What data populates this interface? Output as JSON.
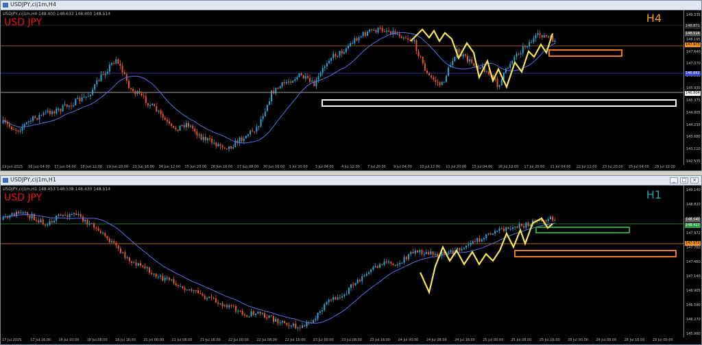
{
  "top": {
    "title": "USDJPY,cij1m,H4",
    "ohlc": "USDJPY,cij1m,H4  148.400 148.633 148.400 148.514",
    "symbol": "USD JPY",
    "timeframe": "H4",
    "timeframe_color": "#f0a020",
    "price_labels": [
      "149.335",
      "148.465",
      "148.195",
      "147.640",
      "147.070",
      "146.500",
      "145.930",
      "145.375",
      "144.805",
      "144.235",
      "143.680",
      "143.110",
      "142.535"
    ],
    "price_tags": [
      {
        "text": "148.871",
        "bg": "#2a2a2a",
        "fg": "#ddd"
      },
      {
        "text": "148.514",
        "bg": "#555",
        "fg": "#fff"
      },
      {
        "text": "147.973",
        "bg": "#f09020",
        "fg": "#000"
      },
      {
        "text": "146.662",
        "bg": "#3b49c9",
        "fg": "#fff"
      },
      {
        "text": "146.804",
        "bg": "#ffffff",
        "fg": "#000"
      }
    ],
    "time_labels": [
      "13 Jun 2025",
      "16 Jun 04:00",
      "17 Jun 04:00",
      "18 Jun 12:00",
      "19 Jun 20:00",
      "23 Jun 16:00",
      "24 Jun 12:00",
      "25 Jun 20:00",
      "26 Jun 16:00",
      "27 Jun 08:00",
      "30 Jun 16:00",
      "1 Jul 20:00",
      "3 Jul 04:00",
      "4 Jul 12:00",
      "7 Jul 20:00",
      "9 Jul 04:00",
      "10 Jul 12:00",
      "11 Jul 20:00",
      "15 Jul 04:00",
      "16 Jul 12:00",
      "17 Jul 20:00",
      "21 Jul 04:00",
      "22 Jul 12:00",
      "23 Jul 20:00",
      "25 Jul 04:00",
      "28 Jul 12:00"
    ]
  },
  "bottom": {
    "title": "USDJPY,cij1m,H1",
    "ohlc": "USDJPY,cij1m,H1  148.453 148.538 148.430 148.514",
    "symbol": "USD JPY",
    "timeframe": "H1",
    "timeframe_color": "#2aa3a3",
    "price_labels": [
      "149.140",
      "148.820",
      "148.305",
      "147.972",
      "147.760",
      "147.460",
      "147.140",
      "146.905",
      "146.590",
      "146.270",
      "145.960"
    ],
    "price_tags": [
      {
        "text": "148.540",
        "bg": "#555",
        "fg": "#fff"
      },
      {
        "text": "148.427",
        "bg": "#2ea040",
        "fg": "#fff"
      },
      {
        "text": "147.972",
        "bg": "#f09020",
        "fg": "#000"
      }
    ],
    "time_labels": [
      "17 Jul 2025",
      "17 Jul 16:00",
      "18 Jul 00:00",
      "18 Jul 08:00",
      "18 Jul 16:00",
      "21 Jul 00:00",
      "21 Jul 08:00",
      "21 Jul 16:00",
      "22 Jul 00:00",
      "22 Jul 08:00",
      "22 Jul 16:00",
      "23 Jul 00:00",
      "23 Jul 08:00",
      "23 Jul 16:00",
      "24 Jul 00:00",
      "24 Jul 08:00",
      "24 Jul 16:00",
      "25 Jul 00:00",
      "25 Jul 08:00",
      "25 Jul 16:00",
      "28 Jul 00:00",
      "28 Jul 08:00",
      "28 Jul 16:00",
      "29 Jul 00:00"
    ]
  },
  "colors": {
    "bull": "#2aa3d6",
    "bear": "#e8572a",
    "ma": "#5a6ff0",
    "zigzag": "#f5e65a",
    "zone_white": "#ffffff",
    "zone_orange": "#f07a1a",
    "zone_green": "#2ea040"
  }
}
